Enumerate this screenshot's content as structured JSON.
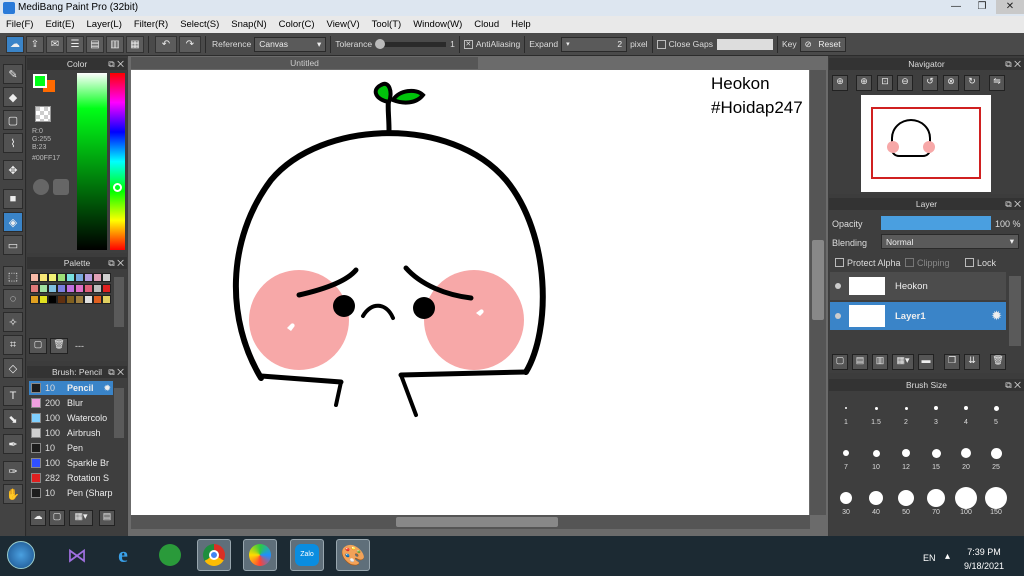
{
  "window": {
    "title": "MediBang Paint Pro (32bit)"
  },
  "menu": [
    "File(F)",
    "Edit(E)",
    "Layer(L)",
    "Filter(R)",
    "Select(S)",
    "Snap(N)",
    "Color(C)",
    "View(V)",
    "Tool(T)",
    "Window(W)",
    "Cloud",
    "Help"
  ],
  "toolbar": {
    "reference_label": "Reference",
    "reference_value": "Canvas",
    "tolerance_label": "Tolerance",
    "tolerance_value": "1",
    "antialiasing_label": "AntiAliasing",
    "expand_label": "Expand",
    "expand_value": "2",
    "expand_unit": "pixel",
    "closegaps_label": "Close Gaps",
    "key_label": "Key",
    "reset_label": "Reset"
  },
  "color_panel": {
    "title": "Color",
    "r": "R:0",
    "g": "G:255",
    "b": "B:23",
    "hex": "#00FF17",
    "primary_color": "#00ff17",
    "secondary_color": "#ff6a00"
  },
  "palette_panel": {
    "title": "Palette",
    "extra": "---",
    "colors": [
      "#f7b9a6",
      "#f7e676",
      "#f2f276",
      "#9de077",
      "#78e0e0",
      "#79a9e0",
      "#b59fe0",
      "#e0a0b6",
      "#cfcfcf",
      "#e07a79",
      "#a1e0a0",
      "#7fbfe0",
      "#7a7fe0",
      "#c070e0",
      "#e070c8",
      "#e0607a",
      "#bfbfbf",
      "#e02020",
      "#e0a020",
      "#e0e020",
      "#000000",
      "#603010",
      "#806020",
      "#a08040",
      "#e0e0e0",
      "#e06020",
      "#e0d060"
    ]
  },
  "brush_panel": {
    "title": "Brush: Pencil",
    "items": [
      {
        "size": "10",
        "name": "Pencil",
        "color": "#1c1c1c"
      },
      {
        "size": "200",
        "name": "Blur",
        "color": "#f0a0e0"
      },
      {
        "size": "100",
        "name": "Watercolo",
        "color": "#80d0ff"
      },
      {
        "size": "100",
        "name": "Airbrush",
        "color": "#cfcfcf"
      },
      {
        "size": "10",
        "name": "Pen",
        "color": "#1c1c1c"
      },
      {
        "size": "100",
        "name": "Sparkle Br",
        "color": "#3050ff"
      },
      {
        "size": "282",
        "name": "Rotation S",
        "color": "#e02020"
      },
      {
        "size": "10",
        "name": "Pen (Sharp",
        "color": "#1c1c1c"
      }
    ]
  },
  "document": {
    "tab": "Untitled"
  },
  "canvas_text": {
    "line1": "Heokon",
    "line2": "#Hoidap247"
  },
  "navigator_panel": {
    "title": "Navigator"
  },
  "layer_panel": {
    "title": "Layer",
    "opacity_label": "Opacity",
    "opacity_value": "100 %",
    "opacity_fraction": 1.0,
    "blending_label": "Blending",
    "blending_value": "Normal",
    "protect_alpha": "Protect Alpha",
    "clipping": "Clipping",
    "lock": "Lock",
    "layers": [
      {
        "name": "Heokon",
        "selected": false
      },
      {
        "name": "Layer1",
        "selected": true
      }
    ]
  },
  "brush_size_panel": {
    "title": "Brush Size",
    "sizes": [
      "1",
      "1.5",
      "2",
      "3",
      "4",
      "5",
      "7",
      "10",
      "12",
      "15",
      "20",
      "25",
      "30",
      "40",
      "50",
      "70",
      "100",
      "150"
    ]
  },
  "taskbar": {
    "language": "EN",
    "time": "7:39 PM",
    "date": "9/18/2021"
  }
}
